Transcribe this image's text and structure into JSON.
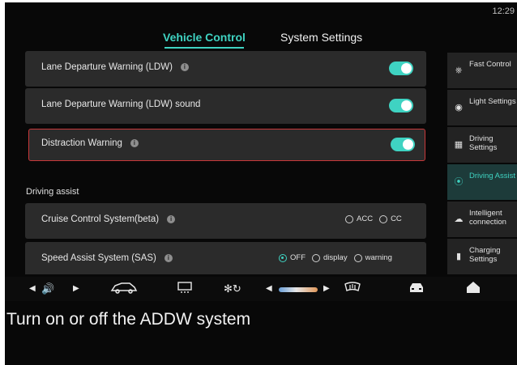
{
  "status": {
    "time": "12:29"
  },
  "tabs": [
    {
      "label": "Vehicle Control",
      "active": true
    },
    {
      "label": "System Settings",
      "active": false
    }
  ],
  "settings": [
    {
      "label": "Lane Departure Warning (LDW)",
      "info": true,
      "toggle": "on"
    },
    {
      "label": "Lane Departure Warning (LDW) sound",
      "info": false,
      "toggle": "on"
    },
    {
      "label": "Distraction Warning",
      "info": true,
      "toggle": "on",
      "highlighted": true
    }
  ],
  "section_title": "Driving assist",
  "cruise": {
    "label": "Cruise Control System(beta)",
    "options": [
      "ACC",
      "CC"
    ],
    "selected": null
  },
  "sas": {
    "label": "Speed Assist System (SAS)",
    "options": [
      "OFF",
      "display",
      "warning"
    ],
    "selected": "OFF"
  },
  "sidebar": [
    {
      "label": "Fast Control",
      "icon": "steering-wheel-icon"
    },
    {
      "label": "Light Settings",
      "icon": "light-icon"
    },
    {
      "label": "Driving Settings",
      "icon": "driving-settings-icon"
    },
    {
      "label": "Driving Assist",
      "icon": "steering-assist-icon",
      "active": true
    },
    {
      "label": "Intelligent connection",
      "icon": "cloud-car-icon"
    },
    {
      "label": "Charging Settings",
      "icon": "battery-icon"
    }
  ],
  "bottom_icons": [
    "volume-icon",
    "car-door-icon",
    "rear-defrost-icon",
    "fan-icon",
    "temperature-slider",
    "front-defrost-icon",
    "car-front-icon",
    "home-icon"
  ],
  "caption": "Turn on or off the ADDW system",
  "colors": {
    "accent": "#3fd3c2",
    "highlight_border": "#c8383a",
    "background": "#080808",
    "row": "#2b2b2b"
  }
}
